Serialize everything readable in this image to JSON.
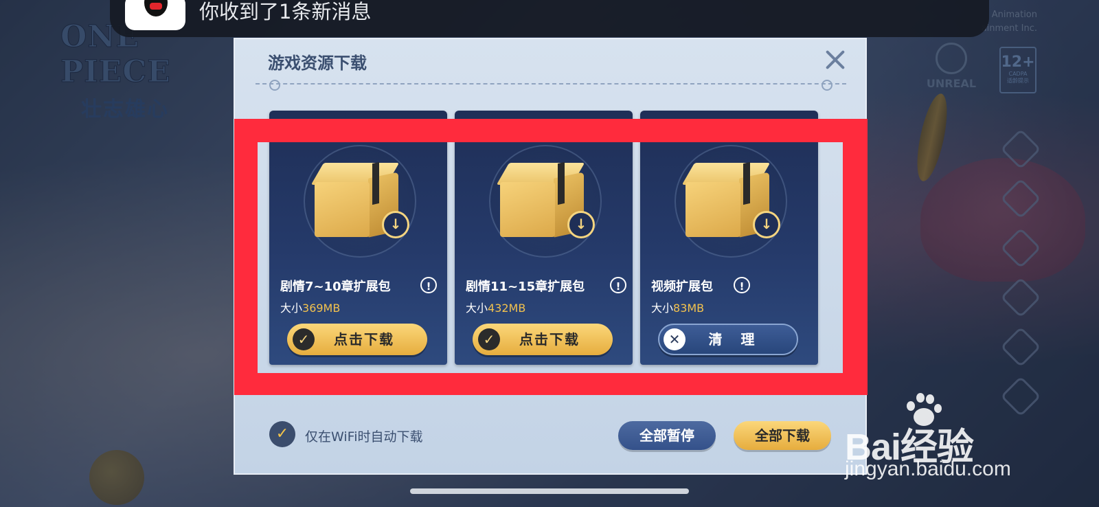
{
  "notification": {
    "text": "你收到了1条新消息"
  },
  "background": {
    "logo_title": "ONE PIECE",
    "logo_subtitle": "壮志雄心",
    "copyright_line1": "Animation",
    "copyright_line2": "ainment Inc.",
    "engine_label": "UNREAL",
    "age_rating": "12+",
    "age_rating_org": "CADPA",
    "age_rating_note": "适龄提示"
  },
  "dialog": {
    "title": "游戏资源下载",
    "packages": [
      {
        "name": "剧情7~10章扩展包",
        "size_label": "大小",
        "size_value": "369MB",
        "action_label": "点击下载",
        "action_icon": "checkmark-icon",
        "state": "download"
      },
      {
        "name": "剧情11~15章扩展包",
        "size_label": "大小",
        "size_value": "432MB",
        "action_label": "点击下载",
        "action_icon": "checkmark-icon",
        "state": "download"
      },
      {
        "name": "视频扩展包",
        "size_label": "大小",
        "size_value": "83MB",
        "action_label": "清 理",
        "action_icon": "close-icon",
        "state": "downloaded"
      }
    ],
    "wifi_option": {
      "label": "仅在WiFi时自动下载",
      "checked": true
    },
    "pause_all_label": "全部暂停",
    "download_all_label": "全部下载"
  },
  "watermark": {
    "brand": "Bai经验",
    "url": "jingyan.baidu.com"
  },
  "colors": {
    "highlight": "#ff2b3d",
    "gold": "#f3c24e",
    "card_bg": "#253a6a",
    "dialog_bg": "#d7e2ef"
  }
}
